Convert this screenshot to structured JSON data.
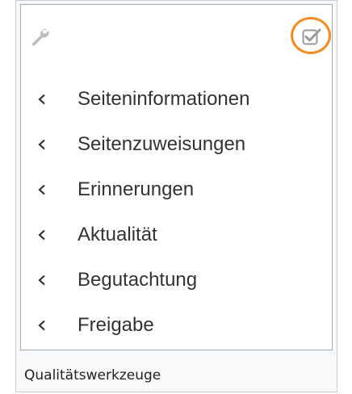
{
  "icons": {
    "tools": "wrench-icon",
    "check": "checkbox-checked-icon",
    "chevron": "chevron-left-icon"
  },
  "colors": {
    "highlight_circle": "#f48a20",
    "icon_gray": "#bcbcbc",
    "text": "#333333"
  },
  "menu": {
    "items": [
      {
        "label": "Seiteninformationen"
      },
      {
        "label": "Seitenzuweisungen"
      },
      {
        "label": "Erinnerungen"
      },
      {
        "label": "Aktualität"
      },
      {
        "label": "Begutachtung"
      },
      {
        "label": "Freigabe"
      }
    ]
  },
  "caption": "Qualitätswerkzeuge"
}
